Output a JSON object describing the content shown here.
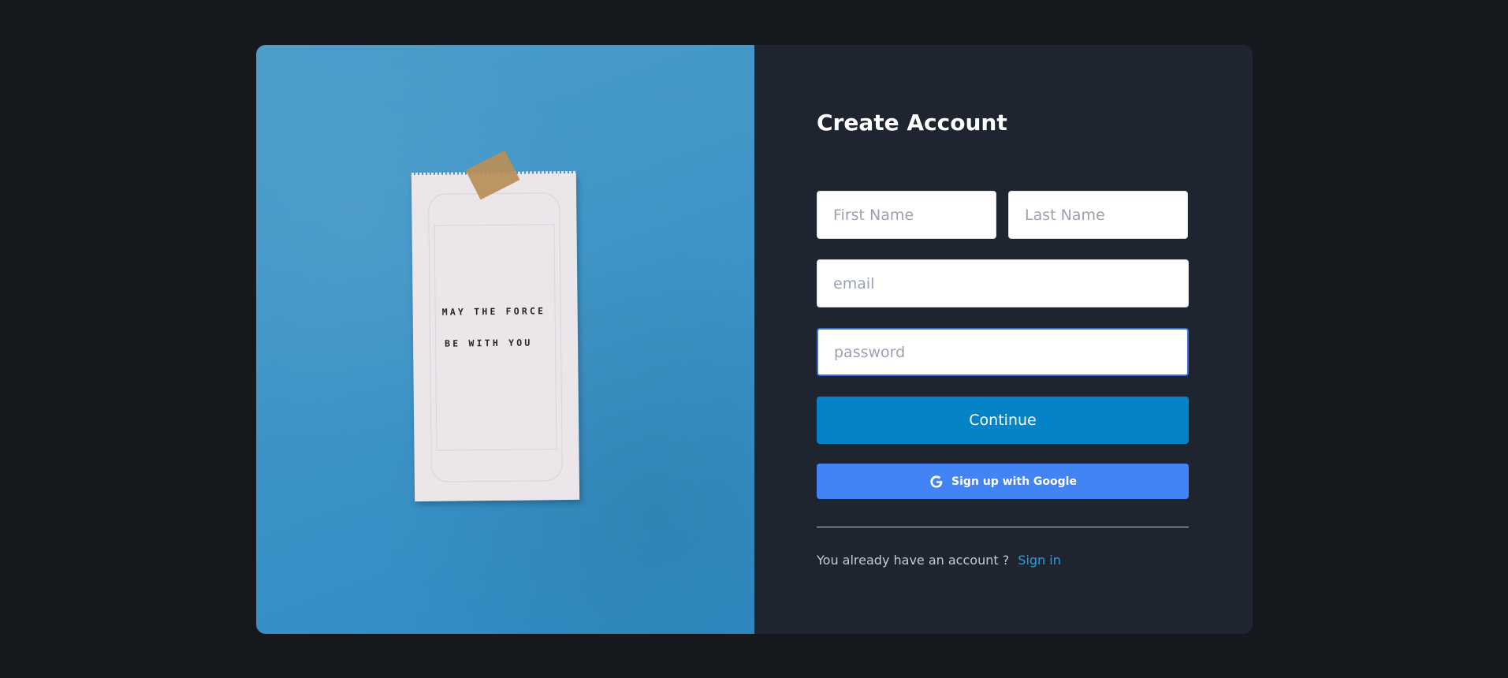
{
  "illustration": {
    "note_line_1": "MAY THE FORCE",
    "note_line_2": "BE WITH YOU",
    "background_color": "#3f94c7"
  },
  "form": {
    "title": "Create Account",
    "first_name_placeholder": "First Name",
    "last_name_placeholder": "Last Name",
    "email_placeholder": "email",
    "password_placeholder": "password",
    "continue_label": "Continue",
    "google_label": "Sign up with Google",
    "google_icon": "google-icon",
    "signin_prompt": "You already have an account ?",
    "signin_link": "Sign in"
  },
  "colors": {
    "page_background": "#15181c",
    "panel_background": "#1f2431",
    "continue_button": "#0583c7",
    "google_button": "#4284f3",
    "link": "#1ea1e6"
  }
}
